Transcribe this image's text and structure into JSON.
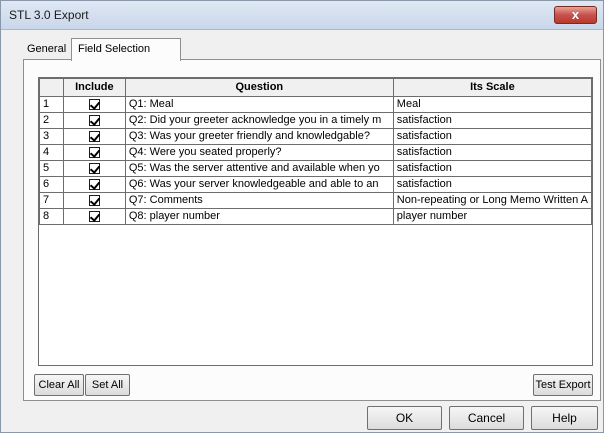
{
  "window": {
    "title": "STL 3.0 Export",
    "close_glyph": "x"
  },
  "tabs": [
    {
      "label": "General",
      "active": false
    },
    {
      "label": "Field Selection",
      "active": true
    }
  ],
  "grid": {
    "columns": [
      "",
      "Include",
      "Question",
      "Its Scale"
    ],
    "rows": [
      {
        "num": "1",
        "include": true,
        "question": "Q1: Meal",
        "scale": "Meal"
      },
      {
        "num": "2",
        "include": true,
        "question": "Q2: Did your greeter acknowledge you in a timely m",
        "scale": "satisfaction"
      },
      {
        "num": "3",
        "include": true,
        "question": "Q3: Was your greeter friendly and knowledgable?",
        "scale": "satisfaction"
      },
      {
        "num": "4",
        "include": true,
        "question": "Q4: Were you seated properly?",
        "scale": "satisfaction"
      },
      {
        "num": "5",
        "include": true,
        "question": "Q5: Was the server attentive and available when yo",
        "scale": "satisfaction"
      },
      {
        "num": "6",
        "include": true,
        "question": "Q6: Was your server knowledgeable and able to an",
        "scale": "satisfaction"
      },
      {
        "num": "7",
        "include": true,
        "question": "Q7: Comments",
        "scale": "Non-repeating or Long Memo Written A"
      },
      {
        "num": "8",
        "include": true,
        "question": "Q8: player number",
        "scale": "player number"
      }
    ]
  },
  "panel_buttons": {
    "clear_all": "Clear All",
    "set_all": "Set All",
    "test_export": "Test Export"
  },
  "footer_buttons": {
    "ok": "OK",
    "cancel": "Cancel",
    "help": "Help"
  }
}
